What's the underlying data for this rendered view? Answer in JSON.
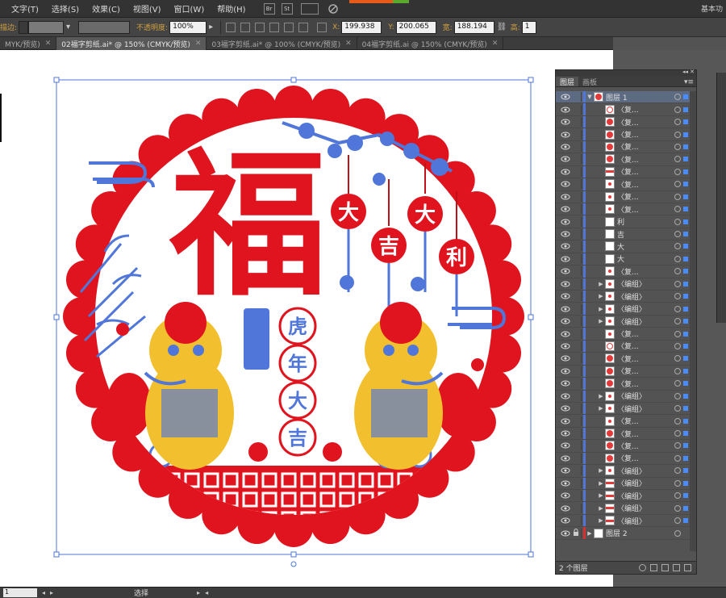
{
  "menubar": {
    "items": [
      "文字(T)",
      "选择(S)",
      "效果(C)",
      "视图(V)",
      "窗口(W)",
      "帮助(H)"
    ],
    "bridge_label": "Br",
    "stock_label": "St",
    "workspace": "基本功"
  },
  "controlbar": {
    "stroke_label": "描边:",
    "opacity_label": "不透明度:",
    "opacity_value": "100%",
    "x_label": "X:",
    "x_value": "199.938",
    "y_label": "Y:",
    "y_value": "200.065",
    "w_label": "宽:",
    "w_value": "188.194",
    "h_label": "高:",
    "h_value": "1"
  },
  "tabs": [
    {
      "label": "MYK/预览)",
      "active": false
    },
    {
      "label": "02福字剪纸.ai* @ 150% (CMYK/预览)",
      "active": true
    },
    {
      "label": "03福字剪纸.ai* @ 100% (CMYK/预览)",
      "active": false
    },
    {
      "label": "04福字剪纸.ai @ 150% (CMYK/预览)",
      "active": false
    }
  ],
  "artwork": {
    "fu": "福",
    "lanterns": [
      "大",
      "吉",
      "大",
      "利"
    ],
    "vertical_text": [
      "虎",
      "年",
      "大",
      "吉"
    ],
    "colors": {
      "red": "#e0141e",
      "blue": "#4f76d8",
      "yellow": "#f2c02e"
    }
  },
  "layers_panel": {
    "tabs": [
      "图层",
      "画板"
    ],
    "rows": [
      {
        "name": "图层 1",
        "thumb": "dot",
        "expand": "▼",
        "top": true
      },
      {
        "name": "〈复...",
        "thumb": "ring",
        "expand": ""
      },
      {
        "name": "〈复...",
        "thumb": "dot",
        "expand": ""
      },
      {
        "name": "〈复...",
        "thumb": "dot",
        "expand": ""
      },
      {
        "name": "〈复...",
        "thumb": "dot",
        "expand": ""
      },
      {
        "name": "〈复...",
        "thumb": "dot",
        "expand": ""
      },
      {
        "name": "〈复...",
        "thumb": "bar",
        "expand": ""
      },
      {
        "name": "〈复...",
        "thumb": "smalldot",
        "expand": ""
      },
      {
        "name": "〈复...",
        "thumb": "smalldot",
        "expand": ""
      },
      {
        "name": "〈复...",
        "thumb": "smalldot",
        "expand": ""
      },
      {
        "name": "利",
        "thumb": "none",
        "expand": ""
      },
      {
        "name": "吉",
        "thumb": "none",
        "expand": ""
      },
      {
        "name": "大",
        "thumb": "none",
        "expand": ""
      },
      {
        "name": "大",
        "thumb": "none",
        "expand": ""
      },
      {
        "name": "〈复...",
        "thumb": "smalldot",
        "expand": ""
      },
      {
        "name": "〈编组〉",
        "thumb": "smalldot",
        "expand": "▶"
      },
      {
        "name": "〈编组〉",
        "thumb": "smalldot",
        "expand": "▶"
      },
      {
        "name": "〈编组〉",
        "thumb": "smalldot",
        "expand": "▶"
      },
      {
        "name": "〈编组〉",
        "thumb": "smalldot",
        "expand": "▶"
      },
      {
        "name": "〈复...",
        "thumb": "smalldot",
        "expand": ""
      },
      {
        "name": "〈复...",
        "thumb": "ring",
        "expand": ""
      },
      {
        "name": "〈复...",
        "thumb": "dot",
        "expand": ""
      },
      {
        "name": "〈复...",
        "thumb": "dot",
        "expand": ""
      },
      {
        "name": "〈复...",
        "thumb": "dot",
        "expand": ""
      },
      {
        "name": "〈编组〉",
        "thumb": "smalldot",
        "expand": "▶"
      },
      {
        "name": "〈编组〉",
        "thumb": "smalldot",
        "expand": "▶"
      },
      {
        "name": "〈复...",
        "thumb": "smalldot",
        "expand": ""
      },
      {
        "name": "〈复...",
        "thumb": "dot",
        "expand": ""
      },
      {
        "name": "〈复...",
        "thumb": "dot",
        "expand": ""
      },
      {
        "name": "〈复...",
        "thumb": "dot",
        "expand": ""
      },
      {
        "name": "〈编组〉",
        "thumb": "smalldot",
        "expand": "▶"
      },
      {
        "name": "〈编组〉",
        "thumb": "bar",
        "expand": "▶"
      },
      {
        "name": "〈编组〉",
        "thumb": "bar",
        "expand": "▶"
      },
      {
        "name": "〈编组〉",
        "thumb": "bar",
        "expand": "▶"
      },
      {
        "name": "〈编组〉",
        "thumb": "bar",
        "expand": "▶"
      },
      {
        "name": "图层 2",
        "thumb": "none",
        "expand": "▶",
        "layer2": true
      }
    ],
    "count": "2 个图层"
  },
  "statusbar": {
    "zoom": "1",
    "tool": "选择"
  }
}
